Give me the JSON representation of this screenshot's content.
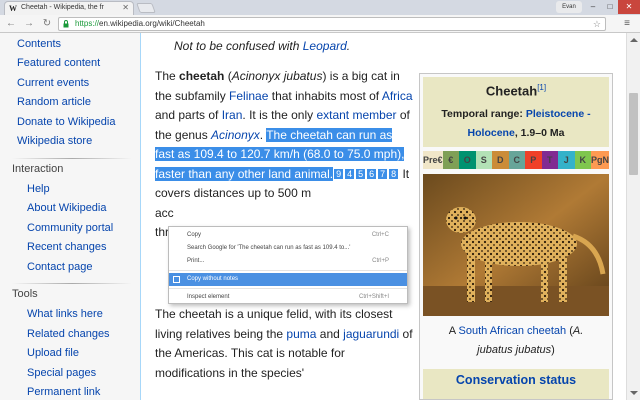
{
  "browser": {
    "tab_title": "Cheetah - Wikipedia, the fr",
    "tab_favicon": "W",
    "profile_name": "Evan",
    "url_scheme": "https://",
    "url_rest": "en.wikipedia.org/wiki/Cheetah",
    "icons": {
      "back": "←",
      "forward": "→",
      "reload": "↻",
      "star": "☆",
      "menu": "≡",
      "close": "✕",
      "minimize": "–",
      "maximize": "□"
    }
  },
  "sidebar": {
    "main_links": [
      "Contents",
      "Featured content",
      "Current events",
      "Random article",
      "Donate to Wikipedia",
      "Wikipedia store"
    ],
    "interaction_heading": "Interaction",
    "interaction_links": [
      "Help",
      "About Wikipedia",
      "Community portal",
      "Recent changes",
      "Contact page"
    ],
    "tools_heading": "Tools",
    "tools_links": [
      "What links here",
      "Related changes",
      "Upload file",
      "Special pages",
      "Permanent link"
    ]
  },
  "hatnote": {
    "prefix": "Not to be confused with ",
    "link": "Leopard",
    "suffix": "."
  },
  "article": {
    "p1": {
      "t1": "The ",
      "b1": "cheetah",
      "t2": " (",
      "i1": "Acinonyx jubatus",
      "t3": ") is a big cat in the subfamily ",
      "a1": "Felinae",
      "t4": " that inhabits most of ",
      "a2": "Africa",
      "t5": " and parts of ",
      "a3": "Iran",
      "t6": ". It is the only ",
      "a4": "extant member",
      "t7": " of the genus ",
      "a5": "Acinonyx",
      "t8": ". ",
      "s1": "The cheetah can run as fast as 109.4 to 120.7 km/h (68.0 to 75.0 mph), faster than any other land animal.",
      "cites": [
        "9",
        "4",
        "5",
        "6",
        "7",
        "8"
      ],
      "t9": " It covers distances up to 500 m",
      "l2": "acc",
      "l3": "thr"
    },
    "p2": {
      "t1": "The cheetah is a unique felid, with its closest living relatives being the ",
      "a1": "puma",
      "t2": " and ",
      "a2": "jaguarundi",
      "t3": " of the Americas. This cat is notable for modifications in the species'"
    }
  },
  "infobox": {
    "title": "Cheetah",
    "title_sup": "[1]",
    "range_label": "Temporal range: ",
    "range_link1": "Pleistocene -",
    "range_link2": "Holocene",
    "range_value": ", 1.9–0 Ma",
    "timebar": [
      {
        "label": "Pre€",
        "color": "#f0e6c8"
      },
      {
        "label": "€",
        "color": "#7fa056"
      },
      {
        "label": "O",
        "color": "#009270"
      },
      {
        "label": "S",
        "color": "#b3e1b6"
      },
      {
        "label": "D",
        "color": "#cb8c37"
      },
      {
        "label": "C",
        "color": "#67a599"
      },
      {
        "label": "P",
        "color": "#f04028"
      },
      {
        "label": "T",
        "color": "#812b92"
      },
      {
        "label": "J",
        "color": "#34b2c9"
      },
      {
        "label": "K",
        "color": "#7fc64e"
      },
      {
        "label": "PgN",
        "color": "#fd9a52"
      }
    ],
    "photo_alt": "cheetah-photo",
    "caption_pre": "A ",
    "caption_link": "South African cheetah",
    "caption_mid": " (",
    "caption_italic1": "A.",
    "caption_italic2": "jubatus jubatus",
    "caption_end": ")",
    "conservation": "Conservation status"
  },
  "context_menu": {
    "items": [
      {
        "label": "Copy",
        "shortcut": "Ctrl+C"
      },
      {
        "label": "Search Google for 'The cheetah can run as fast as 109.4 to...'",
        "shortcut": ""
      },
      {
        "label": "Print...",
        "shortcut": "Ctrl+P"
      },
      {
        "label": "Copy without notes",
        "shortcut": ""
      },
      {
        "label": "Inspect element",
        "shortcut": "Ctrl+Shift+I"
      }
    ]
  }
}
